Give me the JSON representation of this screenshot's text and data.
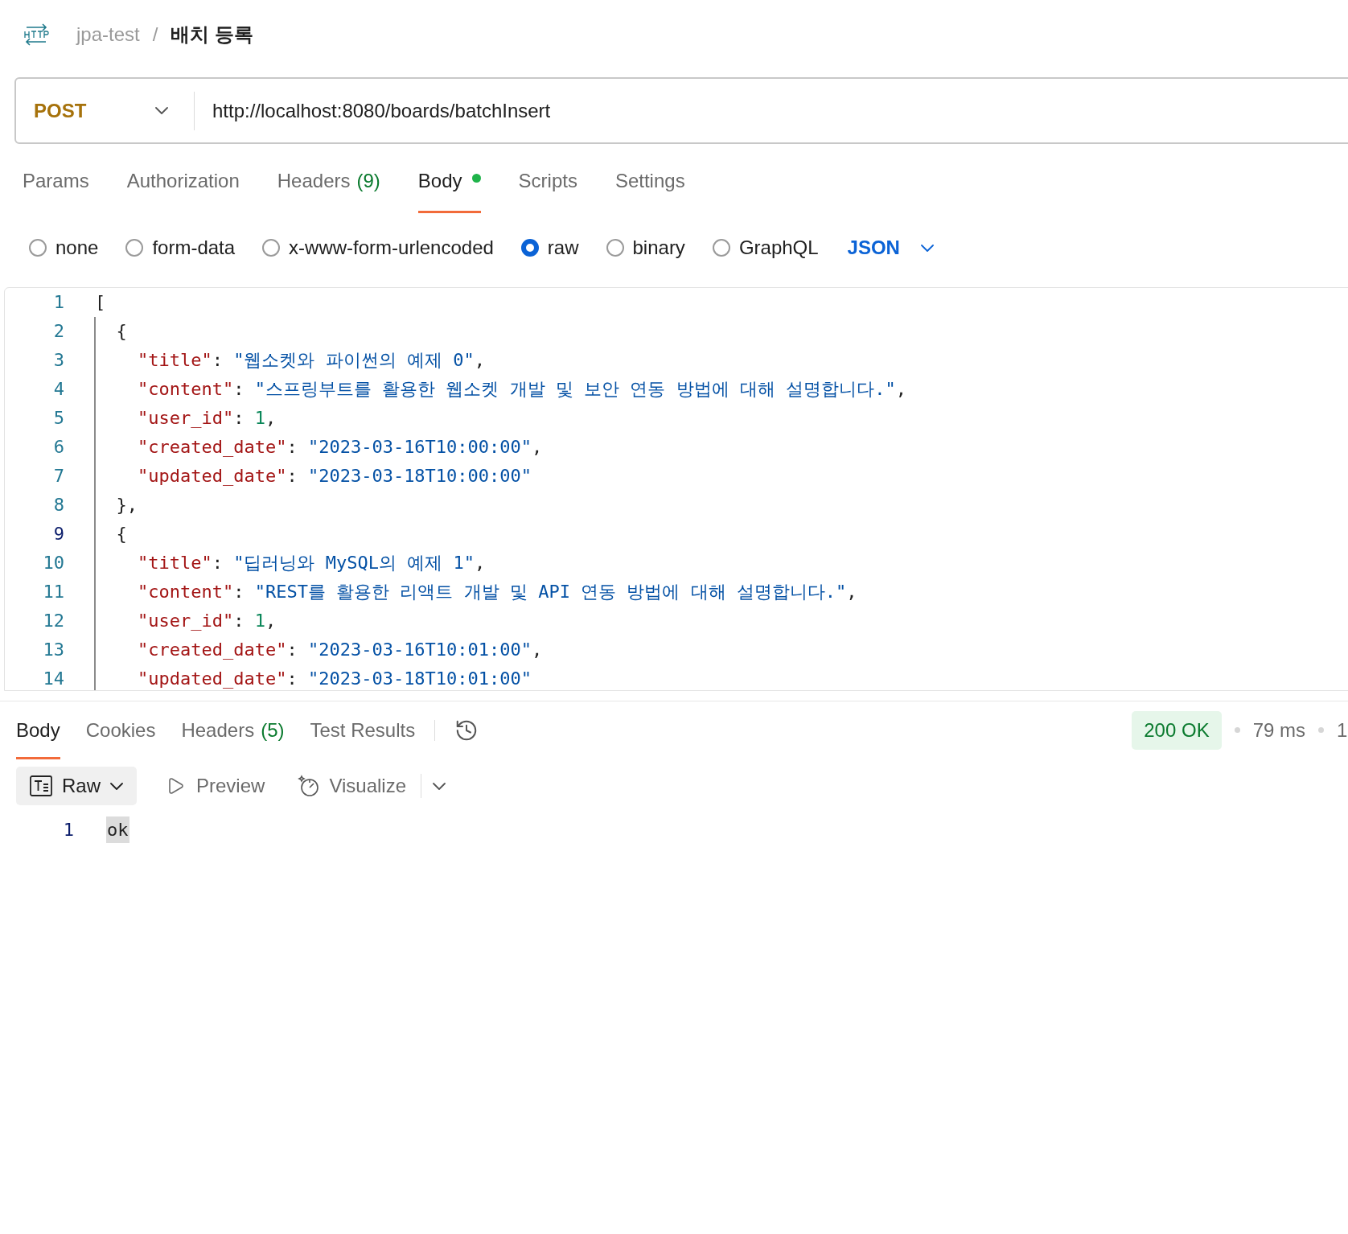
{
  "breadcrumb": {
    "collection": "jpa-test",
    "separator": "/",
    "request": "배치 등록"
  },
  "request": {
    "method": "POST",
    "url": "http://localhost:8080/boards/batchInsert"
  },
  "tabs": [
    {
      "label": "Params",
      "selected": false
    },
    {
      "label": "Authorization",
      "selected": false
    },
    {
      "label": "Headers",
      "count": "(9)",
      "selected": false
    },
    {
      "label": "Body",
      "selected": true,
      "dot": true
    },
    {
      "label": "Scripts",
      "selected": false
    },
    {
      "label": "Settings",
      "selected": false
    }
  ],
  "body_types": [
    {
      "label": "none",
      "selected": false
    },
    {
      "label": "form-data",
      "selected": false
    },
    {
      "label": "x-www-form-urlencoded",
      "selected": false
    },
    {
      "label": "raw",
      "selected": true
    },
    {
      "label": "binary",
      "selected": false
    },
    {
      "label": "GraphQL",
      "selected": false
    }
  ],
  "format": "JSON",
  "editor_lines": [
    {
      "number": "1",
      "active": false,
      "tokens": [
        {
          "kind": "punct",
          "text": "["
        }
      ]
    },
    {
      "number": "2",
      "active": false,
      "tokens": [
        {
          "kind": "punct",
          "text": "  {"
        }
      ]
    },
    {
      "number": "3",
      "active": false,
      "tokens": [
        {
          "kind": "key",
          "text": "    \"title\""
        },
        {
          "kind": "punct",
          "text": ": "
        },
        {
          "kind": "string",
          "text": "\"웹소켓와 파이썬의 예제 0\""
        },
        {
          "kind": "punct",
          "text": ","
        }
      ]
    },
    {
      "number": "4",
      "active": false,
      "tokens": [
        {
          "kind": "key",
          "text": "    \"content\""
        },
        {
          "kind": "punct",
          "text": ": "
        },
        {
          "kind": "string",
          "text": "\"스프링부트를 활용한 웹소켓 개발 및 보안 연동 방법에 대해 설명합니다.\""
        },
        {
          "kind": "punct",
          "text": ","
        }
      ]
    },
    {
      "number": "5",
      "active": false,
      "tokens": [
        {
          "kind": "key",
          "text": "    \"user_id\""
        },
        {
          "kind": "punct",
          "text": ": "
        },
        {
          "kind": "number",
          "text": "1"
        },
        {
          "kind": "punct",
          "text": ","
        }
      ]
    },
    {
      "number": "6",
      "active": false,
      "tokens": [
        {
          "kind": "key",
          "text": "    \"created_date\""
        },
        {
          "kind": "punct",
          "text": ": "
        },
        {
          "kind": "string",
          "text": "\"2023-03-16T10:00:00\""
        },
        {
          "kind": "punct",
          "text": ","
        }
      ]
    },
    {
      "number": "7",
      "active": false,
      "tokens": [
        {
          "kind": "key",
          "text": "    \"updated_date\""
        },
        {
          "kind": "punct",
          "text": ": "
        },
        {
          "kind": "string",
          "text": "\"2023-03-18T10:00:00\""
        }
      ]
    },
    {
      "number": "8",
      "active": false,
      "tokens": [
        {
          "kind": "punct",
          "text": "  },"
        }
      ]
    },
    {
      "number": "9",
      "active": true,
      "tokens": [
        {
          "kind": "punct",
          "text": "  {"
        }
      ]
    },
    {
      "number": "10",
      "active": false,
      "tokens": [
        {
          "kind": "key",
          "text": "    \"title\""
        },
        {
          "kind": "punct",
          "text": ": "
        },
        {
          "kind": "string",
          "text": "\"딥러닝와 MySQL의 예제 1\""
        },
        {
          "kind": "punct",
          "text": ","
        }
      ]
    },
    {
      "number": "11",
      "active": false,
      "tokens": [
        {
          "kind": "key",
          "text": "    \"content\""
        },
        {
          "kind": "punct",
          "text": ": "
        },
        {
          "kind": "string",
          "text": "\"REST를 활용한 리액트 개발 및 API 연동 방법에 대해 설명합니다.\""
        },
        {
          "kind": "punct",
          "text": ","
        }
      ]
    },
    {
      "number": "12",
      "active": false,
      "tokens": [
        {
          "kind": "key",
          "text": "    \"user_id\""
        },
        {
          "kind": "punct",
          "text": ": "
        },
        {
          "kind": "number",
          "text": "1"
        },
        {
          "kind": "punct",
          "text": ","
        }
      ]
    },
    {
      "number": "13",
      "active": false,
      "tokens": [
        {
          "kind": "key",
          "text": "    \"created_date\""
        },
        {
          "kind": "punct",
          "text": ": "
        },
        {
          "kind": "string",
          "text": "\"2023-03-16T10:01:00\""
        },
        {
          "kind": "punct",
          "text": ","
        }
      ]
    },
    {
      "number": "14",
      "active": false,
      "tokens": [
        {
          "kind": "key",
          "text": "    \"updated_date\""
        },
        {
          "kind": "punct",
          "text": ": "
        },
        {
          "kind": "string",
          "text": "\"2023-03-18T10:01:00\""
        }
      ]
    }
  ],
  "response": {
    "tabs": [
      {
        "label": "Body",
        "selected": true
      },
      {
        "label": "Cookies",
        "selected": false
      },
      {
        "label": "Headers",
        "count": "(5)",
        "selected": false
      },
      {
        "label": "Test Results",
        "selected": false
      }
    ],
    "status": "200 OK",
    "time": "79 ms",
    "size": "1",
    "view": "Raw",
    "preview": "Preview",
    "visualize": "Visualize",
    "lines": [
      {
        "number": "1",
        "text": "ok"
      }
    ]
  }
}
